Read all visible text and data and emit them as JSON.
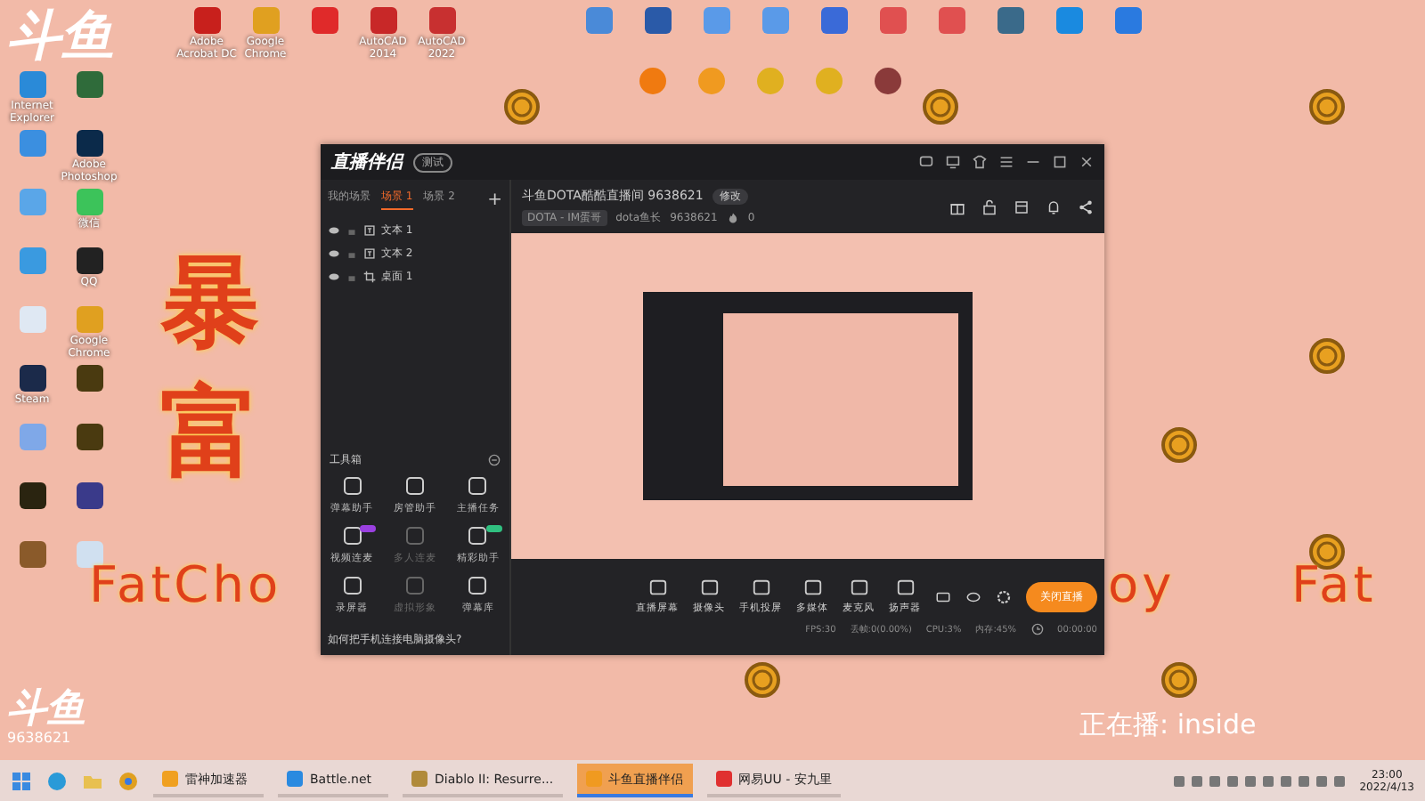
{
  "desktop": {
    "logo": "斗鱼",
    "left_icons": [
      {
        "label": "Internet Explorer",
        "color": "#2a8ad8"
      },
      {
        "color": "#2f6b3a"
      },
      {
        "color": "#3b8fe0"
      },
      {
        "label": "Adobe Photoshop",
        "color": "#0b2a4a"
      },
      {
        "color": "#5aa6e8"
      },
      {
        "label": "微信",
        "color": "#3cc35a"
      },
      {
        "color": "#3a9ae0"
      },
      {
        "label": "QQ",
        "color": "#222222"
      },
      {
        "color": "#dfe8f3"
      },
      {
        "label": "Google Chrome",
        "color": "#e0a020"
      },
      {
        "label": "Steam",
        "color": "#1b2a4a"
      },
      {
        "color": "#4a3a10"
      },
      {
        "color": "#7fa8e8"
      },
      {
        "color": "#4a3a10"
      },
      {
        "color": "#2a2410"
      },
      {
        "color": "#3a3a8a"
      },
      {
        "color": "#8a5a2a"
      },
      {
        "color": "#d0e0f0"
      }
    ],
    "top_icons": [
      {
        "label": "Adobe Acrobat DC",
        "color": "#c8201c"
      },
      {
        "label": "Google Chrome",
        "color": "#e0a020"
      },
      {
        "color": "#e02a2a"
      },
      {
        "label": "AutoCAD 2014",
        "color": "#c82828"
      },
      {
        "label": "AutoCAD 2022",
        "color": "#c83030"
      }
    ],
    "right_icons": [
      {
        "color": "#4a8ad8"
      },
      {
        "color": "#2a5aa8"
      },
      {
        "color": "#5a9ae8"
      },
      {
        "color": "#5a9ae8"
      },
      {
        "color": "#3a6ad8"
      },
      {
        "color": "#e05050"
      },
      {
        "color": "#e05050"
      },
      {
        "color": "#3a6a8a"
      },
      {
        "color": "#1a8ae0"
      },
      {
        "color": "#2a7ae0"
      }
    ],
    "second_row_icons": [
      {
        "color": "#f07a10"
      },
      {
        "color": "#f09a20"
      },
      {
        "color": "#e0b020"
      },
      {
        "color": "#e0b020"
      },
      {
        "color": "#8a3a3a"
      }
    ],
    "big_text": "暴富",
    "fat_choy": [
      "FatCho",
      "oy",
      "Fat"
    ],
    "bottom_logo": "斗鱼",
    "bottom_room": "9638621",
    "now_playing": "正在播: inside"
  },
  "app": {
    "title": "直播伴侣",
    "badge": "测试",
    "scene_tabs": [
      {
        "label": "我的场景",
        "selected": false
      },
      {
        "label": "场景 1",
        "selected": true
      },
      {
        "label": "场景 2",
        "selected": false
      }
    ],
    "add_tab": "+",
    "sources": [
      {
        "label": "文本 1",
        "kind": "text"
      },
      {
        "label": "文本 2",
        "kind": "text"
      },
      {
        "label": "桌面 1",
        "kind": "desktop"
      }
    ],
    "toolbox_title": "工具箱",
    "tools": [
      {
        "label": "弹幕助手",
        "disabled": false
      },
      {
        "label": "房管助手",
        "disabled": false
      },
      {
        "label": "主播任务",
        "disabled": false
      },
      {
        "label": "视频连麦",
        "disabled": false,
        "color": "#9a40e0"
      },
      {
        "label": "多人连麦",
        "disabled": true
      },
      {
        "label": "精彩助手",
        "disabled": false,
        "color": "#30c080"
      },
      {
        "label": "录屏器",
        "disabled": false
      },
      {
        "label": "虚拟形象",
        "disabled": true
      },
      {
        "label": "弹幕库",
        "disabled": false
      }
    ],
    "tip": "如何把手机连接电脑摄像头?",
    "room_title": "斗鱼DOTA酷酷直播间 9638621",
    "edit_button": "修改",
    "category": "DOTA - IM蛋哥",
    "owner": "dota鱼长",
    "room_id": "9638621",
    "heat": "0",
    "sources_bar": [
      {
        "label": "直播屏幕"
      },
      {
        "label": "摄像头"
      },
      {
        "label": "手机投屏"
      },
      {
        "label": "多媒体"
      },
      {
        "label": "麦克风"
      },
      {
        "label": "扬声器"
      }
    ],
    "live_button": "关闭直播",
    "stats": [
      "FPS:30",
      "丢帧:0(0.00%)",
      "CPU:3%",
      "内存:45%"
    ],
    "timer": "00:00:00"
  },
  "taskbar": {
    "apps": [
      {
        "label": "雷神加速器",
        "selected": false,
        "color": "#f0a020"
      },
      {
        "label": "Battle.net",
        "selected": false,
        "color": "#2a8ae0"
      },
      {
        "label": "Diablo II: Resurre...",
        "selected": false,
        "color": "#b08a3a"
      },
      {
        "label": "斗鱼直播伴侣",
        "selected": true,
        "color": "#f09a20"
      },
      {
        "label": "网易UU - 安九里",
        "selected": false,
        "color": "#e03030"
      }
    ],
    "time": "23:00",
    "date": "2022/4/13"
  }
}
